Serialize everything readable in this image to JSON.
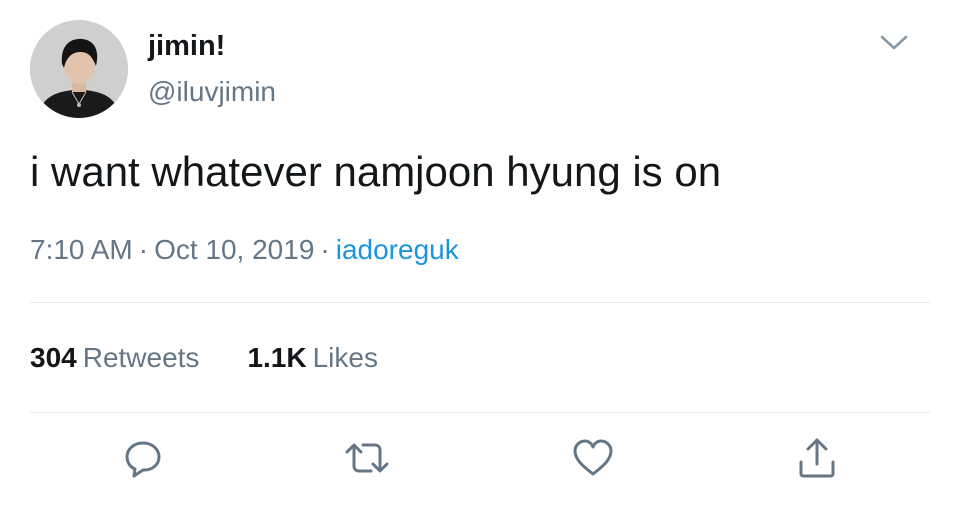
{
  "user": {
    "display_name": "jimin!",
    "handle": "@iluvjimin"
  },
  "tweet": {
    "text": "i want whatever namjoon hyung is on",
    "time": "7:10 AM",
    "date": "Oct 10, 2019",
    "separator": "·",
    "source": "iadoreguk"
  },
  "stats": {
    "retweets_count": "304",
    "retweets_label": "Retweets",
    "likes_count": "1.1K",
    "likes_label": "Likes"
  },
  "icons": {
    "menu": "chevron-down-icon",
    "reply": "reply-icon",
    "retweet": "retweet-icon",
    "like": "heart-icon",
    "share": "share-icon"
  },
  "colors": {
    "text": "#14171a",
    "secondary": "#657786",
    "link": "#1b95e0",
    "divider": "#e1e8ed"
  }
}
